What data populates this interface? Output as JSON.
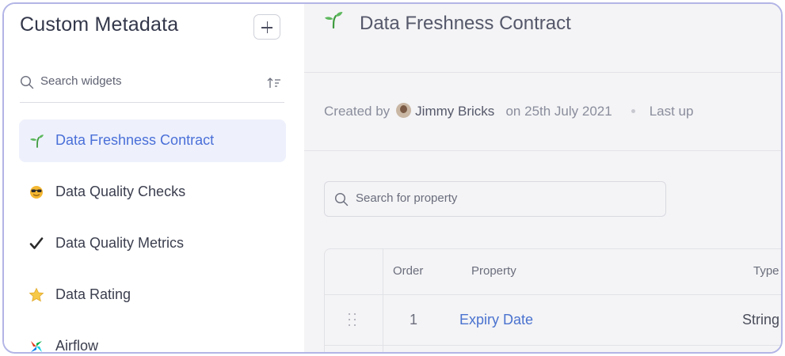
{
  "sidebar": {
    "title": "Custom Metadata",
    "search_placeholder": "Search widgets",
    "items": [
      {
        "label": "Data Freshness Contract",
        "icon": "seedling-icon",
        "active": true
      },
      {
        "label": "Data Quality Checks",
        "icon": "sunglasses-face-icon",
        "active": false
      },
      {
        "label": "Data Quality Metrics",
        "icon": "checkmark-icon",
        "active": false
      },
      {
        "label": "Data Rating",
        "icon": "star-icon",
        "active": false
      },
      {
        "label": "Airflow",
        "icon": "airflow-logo-icon",
        "active": false
      }
    ]
  },
  "main": {
    "title": "Data Freshness Contract",
    "meta": {
      "created_by_label": "Created by",
      "author": "Jimmy Bricks",
      "on_label": "on",
      "created_date": "25th July 2021",
      "last_updated_label": "Last up"
    },
    "search_placeholder": "Search for property",
    "table": {
      "headers": {
        "order": "Order",
        "property": "Property",
        "type": "Type"
      },
      "rows": [
        {
          "order": "1",
          "property": "Expiry Date",
          "type": "String"
        }
      ]
    }
  },
  "colors": {
    "accent": "#4a6fd8",
    "active_bg": "#eef1fc",
    "frame_border": "#b3b5e6",
    "main_bg": "#f4f4f6"
  }
}
